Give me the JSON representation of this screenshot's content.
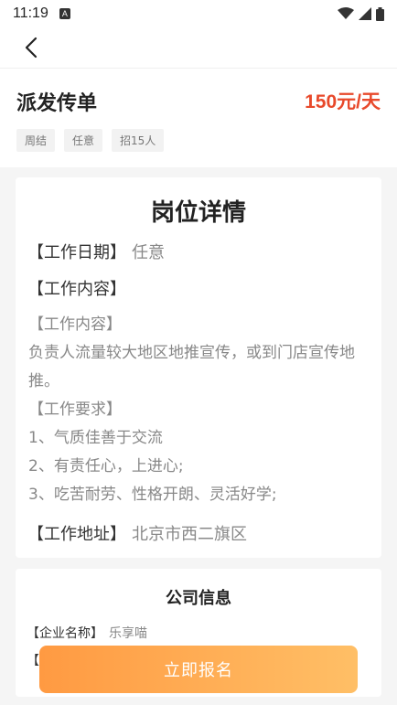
{
  "status_bar": {
    "time": "11:19",
    "notification_icon": "A"
  },
  "header": {
    "back_icon": "chevron-left"
  },
  "job": {
    "title": "派发传单",
    "salary": "150元/天",
    "tags": [
      "周结",
      "任意",
      "招15人"
    ]
  },
  "detail": {
    "heading": "岗位详情",
    "date_label": "【工作日期】",
    "date_value": "任意",
    "content_label": "【工作内容】",
    "description": [
      "【工作内容】",
      "负责人流量较大地区地推宣传，或到门店宣传地推。",
      "【工作要求】",
      "1、气质佳善于交流",
      "2、有责任心，上进心;",
      "3、吃苦耐劳、性格开朗、灵活好学;"
    ],
    "address_label": "【工作地址】",
    "address_value": "北京市西二旗区"
  },
  "company": {
    "heading": "公司信息",
    "name_label": "【企业名称】",
    "name_value": "乐享喵",
    "second_label_partial": "【"
  },
  "actions": {
    "apply_label": "立即报名"
  }
}
